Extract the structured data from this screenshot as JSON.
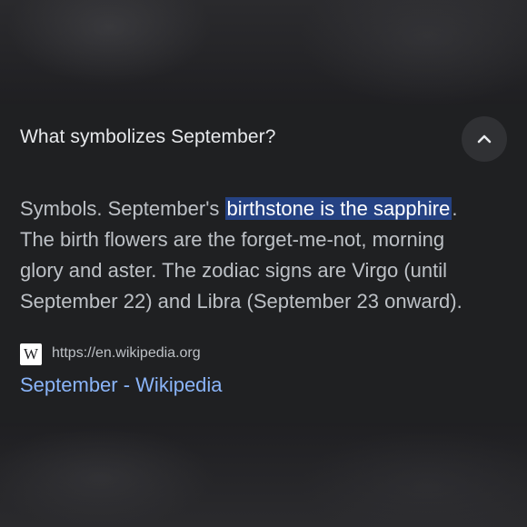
{
  "question": "What symbolizes September?",
  "collapse_icon": "chevron-up-icon",
  "answer": {
    "before": "Symbols. September's ",
    "highlight": "birthstone is the sapphire",
    "after": ". The birth flowers are the forget-me-not, morning glory and aster. The zodiac signs are Virgo (until September 22) and Libra (September 23 onward)."
  },
  "source": {
    "favicon_letter": "W",
    "url": "https://en.wikipedia.org",
    "link_text": "September - Wikipedia"
  },
  "colors": {
    "highlight_bg": "#254283",
    "link": "#8ab4f8",
    "card_bg": "#1f2022"
  }
}
